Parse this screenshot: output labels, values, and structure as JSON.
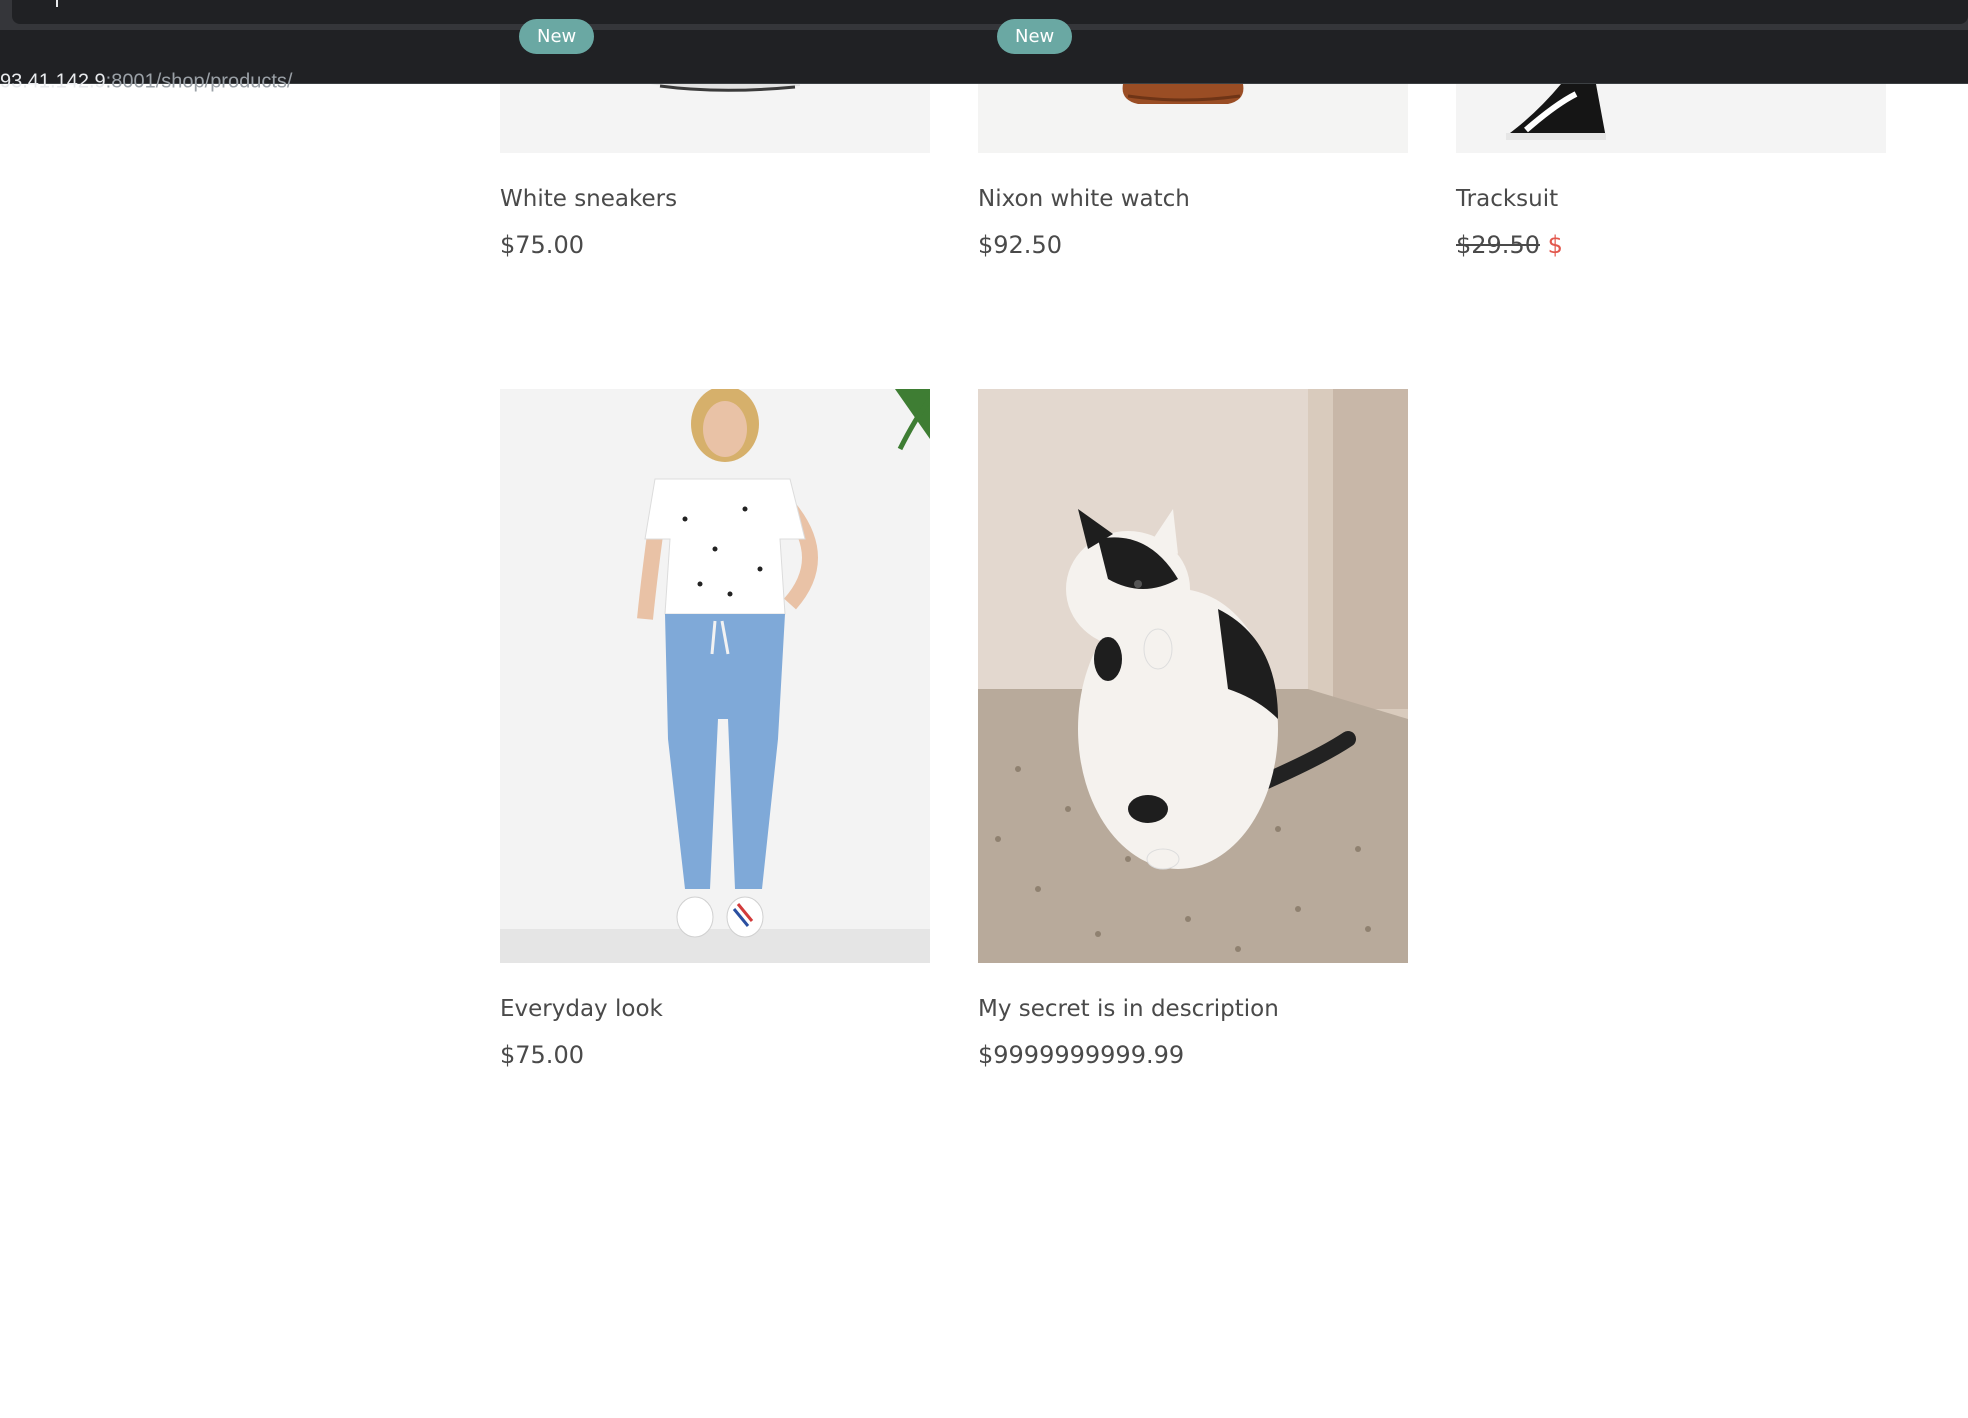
{
  "browser": {
    "url_host": "93.41.142.9",
    "url_path": ":8001/shop/products/"
  },
  "products": [
    {
      "name": "White sneakers",
      "price": "$75.00",
      "badge": "",
      "image": "white-sneakers-photo"
    },
    {
      "name": "Nixon white watch",
      "price": "$92.50",
      "badge": "",
      "image": "watch-photo"
    },
    {
      "name": "Tracksuit",
      "old_price": "$29.50",
      "sale_price": "$",
      "badge": "",
      "image": "sneakers-photo"
    },
    {
      "name": "Everyday look",
      "price": "$75.00",
      "badge": "New",
      "image": "woman-jeans-photo"
    },
    {
      "name": "My secret is in description",
      "price": "$9999999999.99",
      "badge": "New",
      "image": "cat-photo"
    }
  ],
  "colors": {
    "badge": "#6aa8a3",
    "sale": "#e2574c",
    "text": "#4a4a4a",
    "chrome": "#202124"
  }
}
